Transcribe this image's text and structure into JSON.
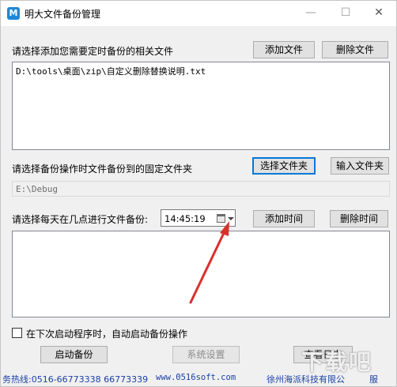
{
  "window": {
    "title": "明大文件备份管理",
    "min_glyph": "—",
    "max_glyph": "☐",
    "close_glyph": "✕"
  },
  "files_section": {
    "label": "请选择添加您需要定时备份的相关文件",
    "add_button": "添加文件",
    "delete_button": "删除文件",
    "items": [
      "D:\\tools\\桌面\\zip\\自定义删除替换说明.txt"
    ]
  },
  "folder_section": {
    "label": "请选择备份操作时文件备份到的固定文件夹",
    "select_button": "选择文件夹",
    "input_button": "输入文件夹",
    "path": "E:\\Debug"
  },
  "time_section": {
    "label": "请选择每天在几点进行文件备份:",
    "time_value": "14:45:19",
    "add_time_button": "添加时间",
    "delete_time_button": "删除时间"
  },
  "options": {
    "autostart_label": "在下次启动程序时，自动启动备份操作",
    "autostart_checked": false
  },
  "actions": {
    "start_button": "启动备份",
    "settings_button": "系统设置",
    "log_button": "查看日志"
  },
  "status_bar": {
    "hotline": "务热线:0516-66773338 66773339",
    "url": "www.0516soft.com",
    "company": "徐州海派科技有限公",
    "service": "服"
  },
  "watermark": {
    "text": "下载吧"
  },
  "colors": {
    "accent": "#0078d7",
    "arrow": "#d9302c",
    "status_text": "#1a3fa8"
  }
}
